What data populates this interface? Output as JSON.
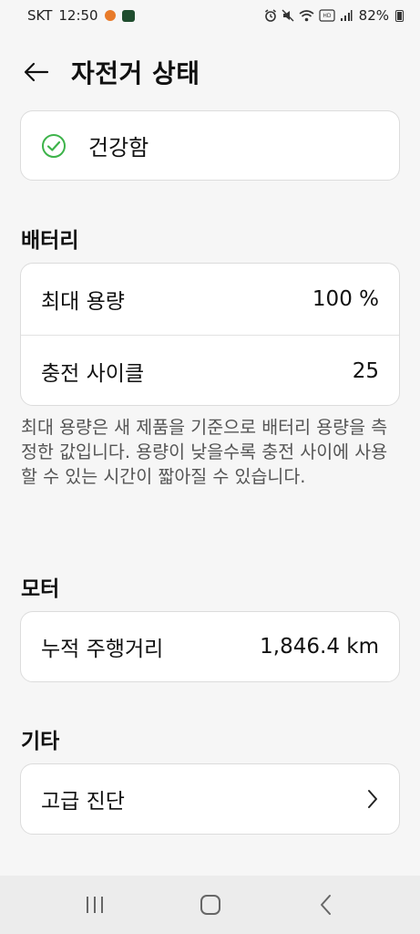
{
  "status_bar": {
    "carrier": "SKT",
    "time": "12:50",
    "battery_percent": "82%",
    "icons": [
      "alarm-icon",
      "mute-icon",
      "wifi-icon",
      "hd-voice-icon",
      "signal-icon",
      "battery-icon"
    ]
  },
  "header": {
    "title": "자전거 상태",
    "back_icon": "arrow-left-icon"
  },
  "health": {
    "icon": "check-circle-icon",
    "label": "건강함",
    "accent_color": "#3db34a"
  },
  "battery_section": {
    "title": "배터리",
    "rows": [
      {
        "label": "최대 용량",
        "value": "100 %"
      },
      {
        "label": "충전 사이클",
        "value": "25"
      }
    ],
    "note": "최대 용량은 새 제품을 기준으로 배터리 용량을 측정한 값입니다. 용량이 낮을수록 충전 사이에 사용할 수 있는 시간이 짧아질 수 있습니다."
  },
  "motor_section": {
    "title": "모터",
    "rows": [
      {
        "label": "누적 주행거리",
        "value": "1,846.4 km"
      }
    ]
  },
  "etc_section": {
    "title": "기타",
    "rows": [
      {
        "label": "고급 진단",
        "icon": "chevron-right-icon"
      }
    ]
  },
  "nav_bar": {
    "buttons": [
      "recent-apps-icon",
      "home-icon",
      "back-icon"
    ]
  }
}
